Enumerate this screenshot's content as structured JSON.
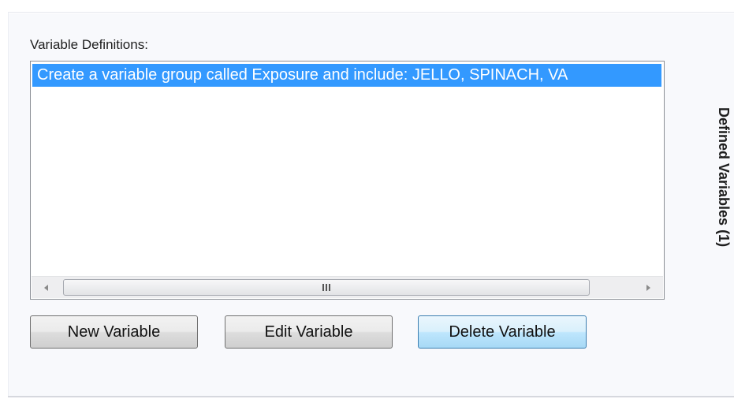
{
  "variable_definitions": {
    "label": "Variable Definitions:",
    "items": [
      {
        "text": "Create a variable group called Exposure and include: JELLO, SPINACH, VA",
        "selected": true
      }
    ],
    "scrollbar": {
      "left_arrow": "◂",
      "right_arrow": "▸"
    }
  },
  "buttons": {
    "new_variable": "New Variable",
    "edit_variable": "Edit Variable",
    "delete_variable": "Delete Variable"
  },
  "side_tab": {
    "label": "Defined Variables (1)"
  },
  "colors": {
    "selection": "#3399ff",
    "hover_button_border": "#3c7fb1"
  }
}
